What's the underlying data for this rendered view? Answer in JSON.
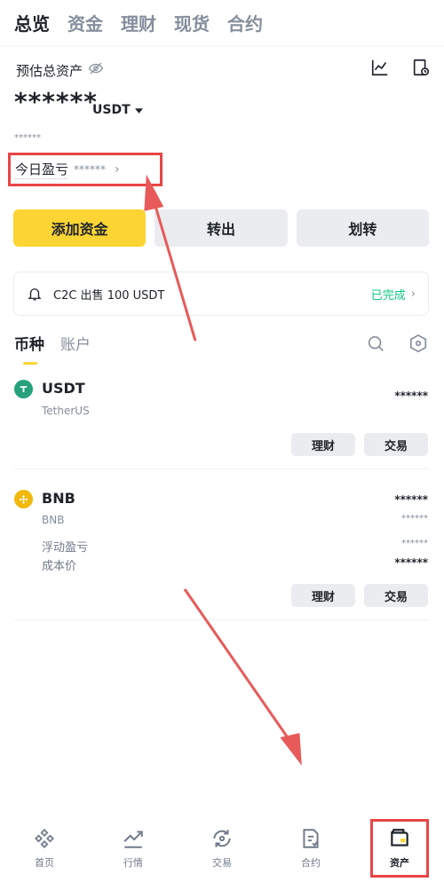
{
  "top_tabs": [
    {
      "label": "总览",
      "active": true
    },
    {
      "label": "资金",
      "active": false
    },
    {
      "label": "理财",
      "active": false
    },
    {
      "label": "现货",
      "active": false
    },
    {
      "label": "合约",
      "active": false
    }
  ],
  "summary": {
    "label": "预估总资产",
    "balance": "******",
    "currency": "USDT",
    "sub_value": "******",
    "pnl_label": "今日盈亏",
    "pnl_value": "******"
  },
  "actions": {
    "deposit": "添加资金",
    "withdraw": "转出",
    "transfer": "划转"
  },
  "notice": {
    "text": "C2C 出售 100 USDT",
    "status": "已完成"
  },
  "list_tabs": [
    {
      "label": "币种",
      "active": true
    },
    {
      "label": "账户",
      "active": false
    }
  ],
  "assets": [
    {
      "symbol": "USDT",
      "name": "TetherUS",
      "amount": "******",
      "earn_label": "理财",
      "trade_label": "交易"
    },
    {
      "symbol": "BNB",
      "name": "BNB",
      "amount": "******",
      "amount_sub": "******",
      "floating_pnl_label": "浮动盈亏",
      "floating_pnl_value": "******",
      "cost_label": "成本价",
      "cost_value": "******",
      "earn_label": "理财",
      "trade_label": "交易"
    }
  ],
  "bottom_nav": [
    {
      "label": "首页",
      "icon": "home-icon",
      "active": false
    },
    {
      "label": "行情",
      "icon": "markets-icon",
      "active": false
    },
    {
      "label": "交易",
      "icon": "trade-icon",
      "active": false
    },
    {
      "label": "合约",
      "icon": "futures-icon",
      "active": false
    },
    {
      "label": "资产",
      "icon": "wallet-icon",
      "active": true
    }
  ],
  "colors": {
    "accent": "#fcd535",
    "success": "#0ecb81",
    "annotation": "#e84545",
    "usdt": "#26a17b",
    "bnb": "#f0b90b"
  }
}
